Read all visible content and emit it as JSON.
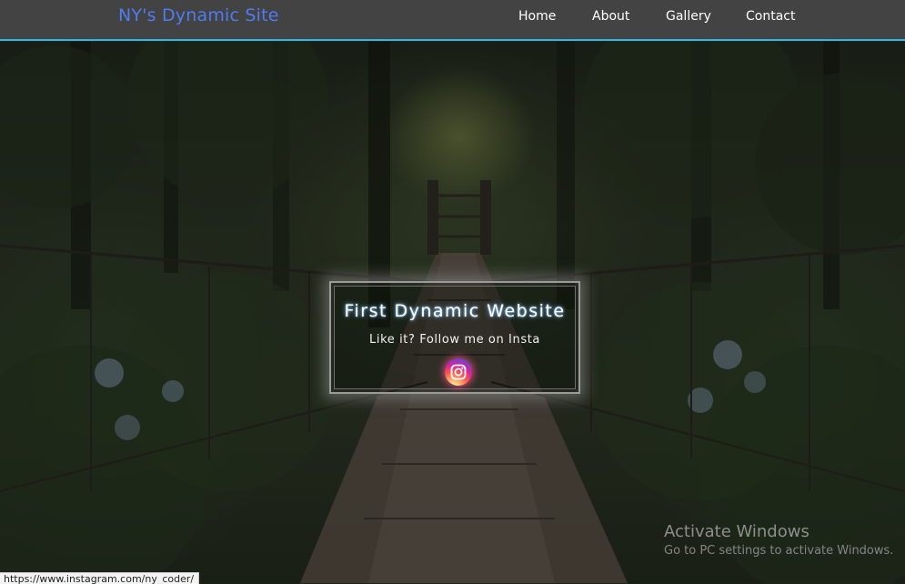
{
  "navbar": {
    "brand": "NY's Dynamic Site",
    "links": [
      "Home",
      "About",
      "Gallery",
      "Contact"
    ]
  },
  "card": {
    "title": "First Dynamic Website",
    "subtitle": "Like it? Follow me on Insta",
    "icon": "instagram-icon"
  },
  "watermark": {
    "title": "Activate Windows",
    "subtitle": "Go to PC settings to activate Windows."
  },
  "statusbar": {
    "url": "https://www.instagram.com/ny_coder/"
  },
  "colors": {
    "navbar_bg": "#434343",
    "navbar_border": "#2fb8e6",
    "brand": "#4f7cf0"
  }
}
